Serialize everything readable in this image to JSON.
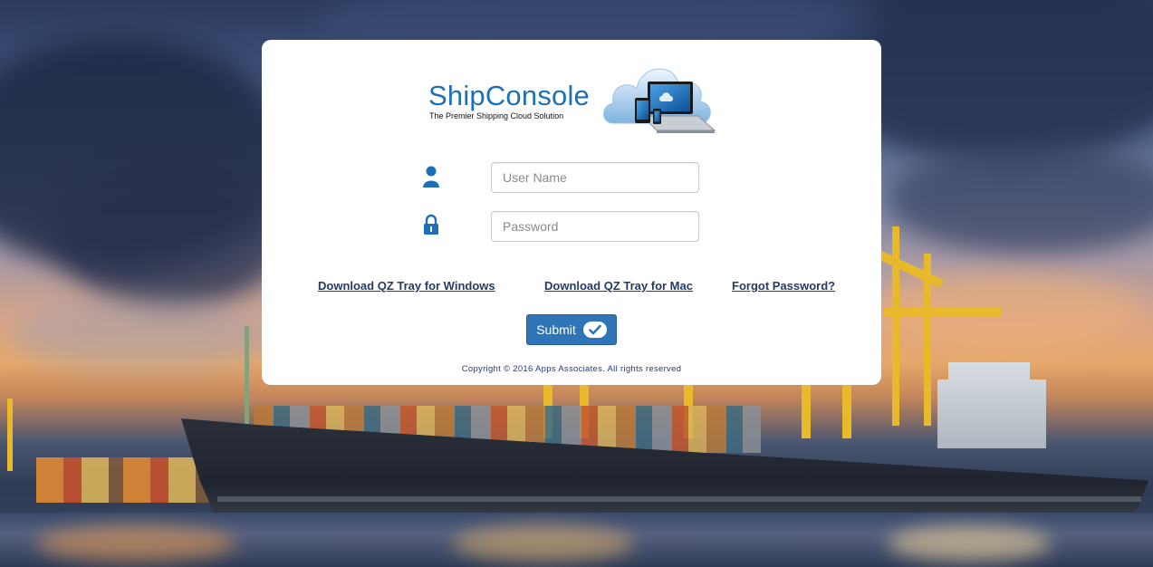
{
  "brand": {
    "name": "ShipConsole",
    "tagline": "The Premier Shipping Cloud Solution"
  },
  "login": {
    "username_placeholder": "User Name",
    "password_placeholder": "Password",
    "submit_label": "Submit"
  },
  "links": {
    "qz_windows": "Download QZ Tray for Windows",
    "qz_mac": "Download QZ Tray for Mac",
    "forgot_password": "Forgot Password?"
  },
  "footer": {
    "copyright": "Copyright © 2016 Apps Associates. All rights reserved"
  },
  "icons": {
    "user": "user-icon",
    "lock": "lock-icon",
    "submit": "check-icon",
    "logo": "cloud-devices-icon"
  },
  "colors": {
    "brand_blue": "#1d6fb8",
    "button_blue": "#2f74b6",
    "link_color": "#243b63",
    "copyright_color": "#1f3a8a"
  }
}
